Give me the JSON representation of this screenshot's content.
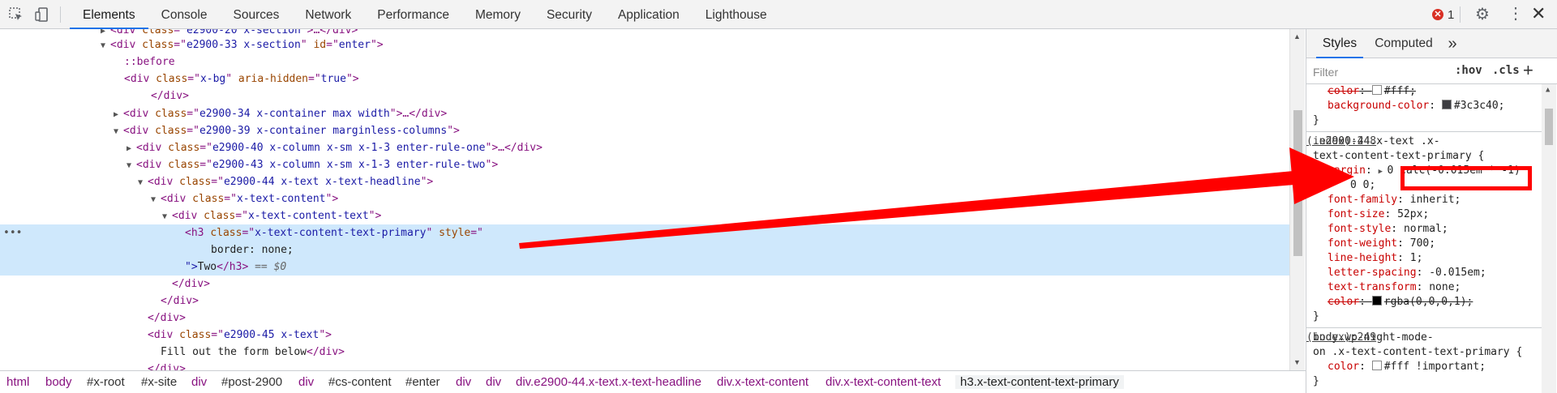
{
  "toolbar": {
    "tabs": [
      "Elements",
      "Console",
      "Sources",
      "Network",
      "Performance",
      "Memory",
      "Security",
      "Application",
      "Lighthouse"
    ],
    "error_count": "1",
    "inspect_icon": "cursor-select-icon",
    "device_icon": "device-toggle-icon",
    "settings_icon": "gear-icon",
    "menu_icon": "kebab-menu-icon",
    "close_icon": "close-icon"
  },
  "elements": {
    "lines": {
      "l0": {
        "pre": "<div ",
        "attr": "class",
        "eq": "=\"",
        "val": "e2900-20 x-section",
        "post": "\">…</div>"
      },
      "l1": {
        "pre": "<div ",
        "attr": "class",
        "val": "e2900-33 x-section",
        "attr2": "id",
        "val2": "enter",
        "post": ">"
      },
      "l2": {
        "text": "::before"
      },
      "l3": {
        "pre": "<div ",
        "attr": "class",
        "val": "x-bg",
        "attr2": "aria-hidden",
        "val2": "true",
        "post": ">"
      },
      "l4": {
        "text": "</div>"
      },
      "l5": {
        "pre": "<div ",
        "attr": "class",
        "val": "e2900-34 x-container max width",
        "post": ">…</div>"
      },
      "l6": {
        "pre": "<div ",
        "attr": "class",
        "val": "e2900-39 x-container marginless-columns",
        "post": ">"
      },
      "l7": {
        "pre": "<div ",
        "attr": "class",
        "val": "e2900-40 x-column x-sm x-1-3 enter-rule-one",
        "post": ">…</div>"
      },
      "l8": {
        "pre": "<div ",
        "attr": "class",
        "val": "e2900-43 x-column x-sm x-1-3 enter-rule-two",
        "post": ">"
      },
      "l9": {
        "pre": "<div ",
        "attr": "class",
        "val": "e2900-44 x-text x-text-headline",
        "post": ">"
      },
      "l10": {
        "pre": "<div ",
        "attr": "class",
        "val": "x-text-content",
        "post": ">"
      },
      "l11": {
        "pre": "<div ",
        "attr": "class",
        "val": "x-text-content-text",
        "post": ">"
      },
      "l12": {
        "pre": "<h3 ",
        "attr": "class",
        "val": "x-text-content-text-primary",
        "attr2": "style",
        "post": ""
      },
      "l13": {
        "text": "border: none;"
      },
      "l14": {
        "pre": "\">",
        "txt": "Two",
        "post": "</h3>",
        "dollar": " == $0"
      },
      "l15": {
        "text": "</div>"
      },
      "l16": {
        "text": "</div>"
      },
      "l17": {
        "text": "</div>"
      },
      "l18": {
        "pre": "<div ",
        "attr": "class",
        "val": "e2900-45 x-text",
        "post": ">"
      },
      "l19": {
        "txt": "Fill out the form below",
        "post": "</div>"
      },
      "l20": {
        "text": "</div>"
      }
    }
  },
  "breadcrumbs": [
    "html",
    "body",
    "#x-root",
    "#x-site",
    "div",
    "#post-2900",
    "div",
    "#cs-content",
    "#enter",
    "div",
    "div",
    "div.e2900-44.x-text.x-text-headline",
    "div.x-text-content",
    "div.x-text-content-text",
    "h3.x-text-content-text-primary"
  ],
  "styles": {
    "tabs": [
      "Styles",
      "Computed",
      "»"
    ],
    "filter_placeholder": "Filter",
    "hov": ":hov",
    "cls": ".cls",
    "plus": "+",
    "r0": {
      "p1": "color",
      "v1": "#fff;",
      "p2": "background-color",
      "v2": "#3c3c40;",
      "close": "}"
    },
    "r1": {
      "selector1": ".e2900-44.x-text .x-",
      "selector2": "text-content-text-primary {",
      "source": "(index):248",
      "props": [
        {
          "p": "margin",
          "v": "0 calc(-0.015em * -1)"
        },
        {
          "p": "",
          "v": "0 0;"
        },
        {
          "p": "font-family",
          "v": "inherit;"
        },
        {
          "p": "font-size",
          "v": "52px;"
        },
        {
          "p": "font-style",
          "v": "normal;"
        },
        {
          "p": "font-weight",
          "v": "700;"
        },
        {
          "p": "line-height",
          "v": "1;"
        },
        {
          "p": "letter-spacing",
          "v": "-0.015em;"
        },
        {
          "p": "text-transform",
          "v": "none;"
        },
        {
          "p": "color",
          "v": "rgba(0,0,0,1);"
        }
      ],
      "close": "}"
    },
    "r2": {
      "selector1": "body.wp-night-mode-",
      "selector2": "on .x-text-content-text-primary {",
      "source": "(index):249",
      "p": "color",
      "v": "#fff !important;",
      "close": "}"
    }
  },
  "colors": {
    "accent": "#1a73e8",
    "annotation": "#ff0000",
    "tag": "#881280",
    "attr": "#994500",
    "value": "#1a1aa6",
    "selected_row": "#cfe8fc"
  }
}
